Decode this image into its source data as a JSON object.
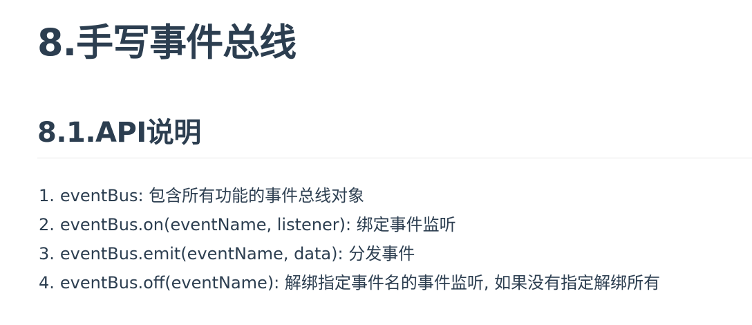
{
  "heading": {
    "title": "8.手写事件总线"
  },
  "section": {
    "title": "8.1.API说明"
  },
  "api_list": [
    {
      "num": "1.",
      "text": "eventBus: 包含所有功能的事件总线对象"
    },
    {
      "num": "2.",
      "text": "eventBus.on(eventName, listener): 绑定事件监听"
    },
    {
      "num": "3.",
      "text": "eventBus.emit(eventName, data): 分发事件"
    },
    {
      "num": "4.",
      "text": "eventBus.off(eventName): 解绑指定事件名的事件监听, 如果没有指定解绑所有"
    }
  ]
}
